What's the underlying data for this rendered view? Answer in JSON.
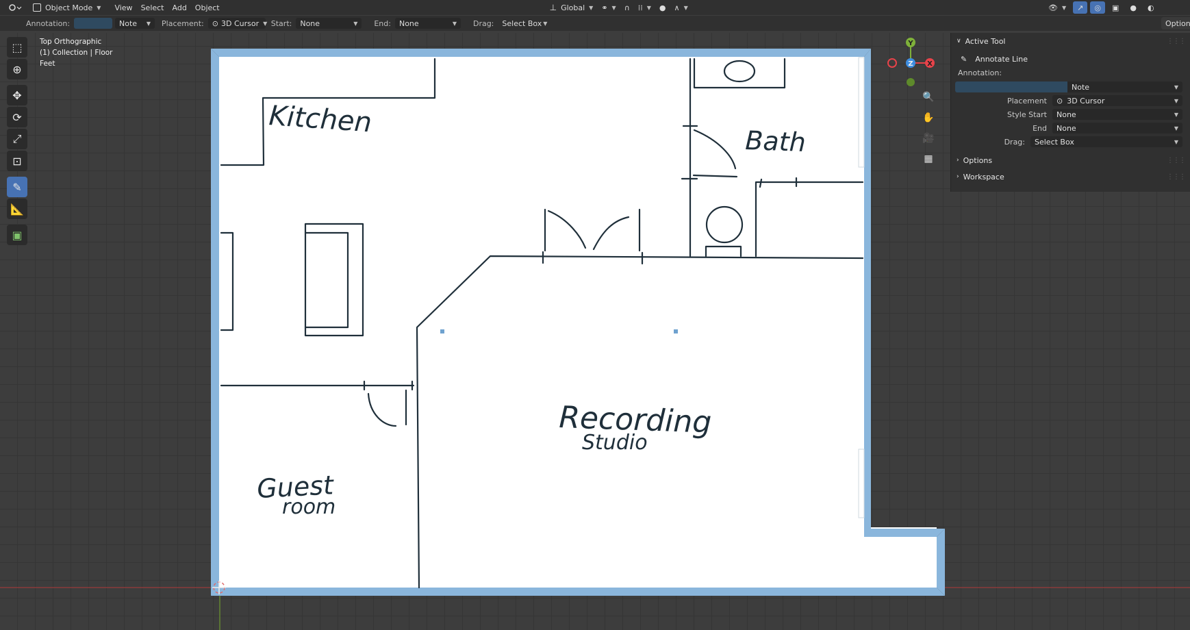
{
  "topbar": {
    "mode": "Object Mode",
    "menus": [
      "View",
      "Select",
      "Add",
      "Object"
    ],
    "orientation": "Global"
  },
  "tool_header": {
    "annotation_label": "Annotation:",
    "annotation_value": "Note",
    "placement_label": "Placement:",
    "placement_value": "3D Cursor",
    "start_label": "Start:",
    "start_value": "None",
    "end_label": "End:",
    "end_value": "None",
    "drag_label": "Drag:",
    "drag_value": "Select Box",
    "options_label": "Options"
  },
  "viewport": {
    "view_name": "Top Orthographic",
    "collection": "(1) Collection | Floor",
    "units": "Feet"
  },
  "gizmo": {
    "x_label": "X",
    "y_label": "Y",
    "z_label": "Z"
  },
  "floorplan_labels": {
    "kitchen": "Kitchen",
    "bath": "Bath",
    "recording": "Recording",
    "studio": "Studio",
    "guest": "Guest",
    "room": "room"
  },
  "npanel": {
    "active_tool_header": "Active Tool",
    "tool_name": "Annotate Line",
    "annotation_label": "Annotation:",
    "annotation_value": "Note",
    "placement_label": "Placement",
    "placement_value": "3D Cursor",
    "style_start_label": "Style Start",
    "style_start_value": "None",
    "end_label": "End",
    "end_value": "None",
    "drag_label": "Drag:",
    "drag_value": "Select Box",
    "options_header": "Options",
    "workspace_header": "Workspace"
  },
  "colors": {
    "wall": "#8ab6dc",
    "ink": "#1f2f3a",
    "accent": "#4772b3",
    "x_axis": "#e8434a",
    "y_axis": "#7fb13a",
    "z_axis": "#3e8de0"
  }
}
